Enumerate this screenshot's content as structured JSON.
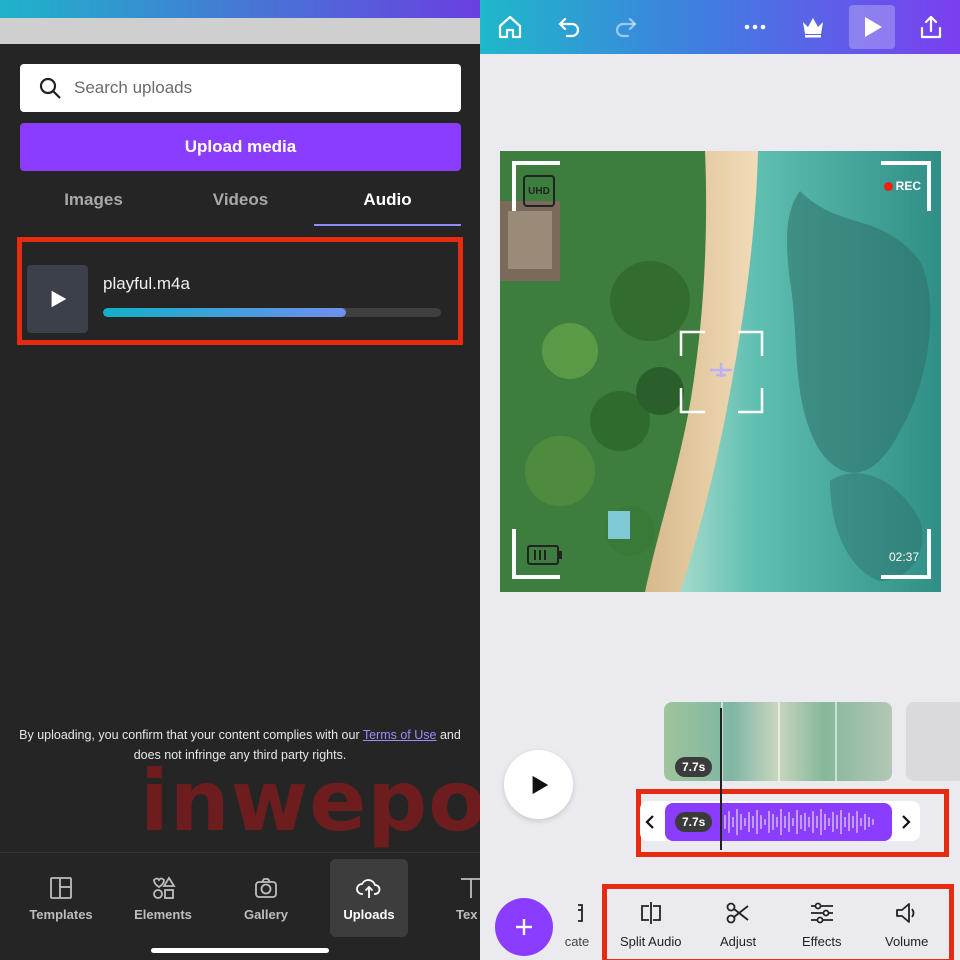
{
  "left": {
    "search": {
      "placeholder": "Search uploads"
    },
    "upload_button": "Upload media",
    "tabs": [
      {
        "label": "Images",
        "active": false
      },
      {
        "label": "Videos",
        "active": false
      },
      {
        "label": "Audio",
        "active": true
      }
    ],
    "audio_item": {
      "filename": "playful.m4a",
      "upload_progress": 0.72
    },
    "terms": {
      "prefix": "By uploading, you confirm that your content complies with our ",
      "link": "Terms of Use",
      "suffix": " and does not infringe any third party rights."
    },
    "watermark": "inwepo",
    "nav": [
      {
        "label": "Templates",
        "icon": "templates-icon",
        "active": false
      },
      {
        "label": "Elements",
        "icon": "elements-icon",
        "active": false
      },
      {
        "label": "Gallery",
        "icon": "gallery-icon",
        "active": false
      },
      {
        "label": "Uploads",
        "icon": "upload-cloud-icon",
        "active": true
      },
      {
        "label": "Tex",
        "icon": "text-icon",
        "active": false
      }
    ]
  },
  "right": {
    "toolbar": {
      "icons": [
        "home-icon",
        "undo-icon",
        "redo-icon",
        "more-icon",
        "crown-icon",
        "play-icon",
        "share-icon"
      ]
    },
    "canvas": {
      "rec_label": "REC",
      "timecode": "02:37",
      "uhd_label": "UHD"
    },
    "timeline": {
      "video_duration": "7.7s",
      "audio_duration": "7.7s"
    },
    "tools": [
      {
        "label": "cate",
        "icon": "duplicate-icon"
      },
      {
        "label": "Split Audio",
        "icon": "split-audio-icon"
      },
      {
        "label": "Adjust",
        "icon": "scissors-icon"
      },
      {
        "label": "Effects",
        "icon": "sliders-icon"
      },
      {
        "label": "Volume",
        "icon": "volume-icon"
      }
    ]
  },
  "colors": {
    "brand_purple": "#8b3dff",
    "highlight_red": "#e62b10"
  }
}
